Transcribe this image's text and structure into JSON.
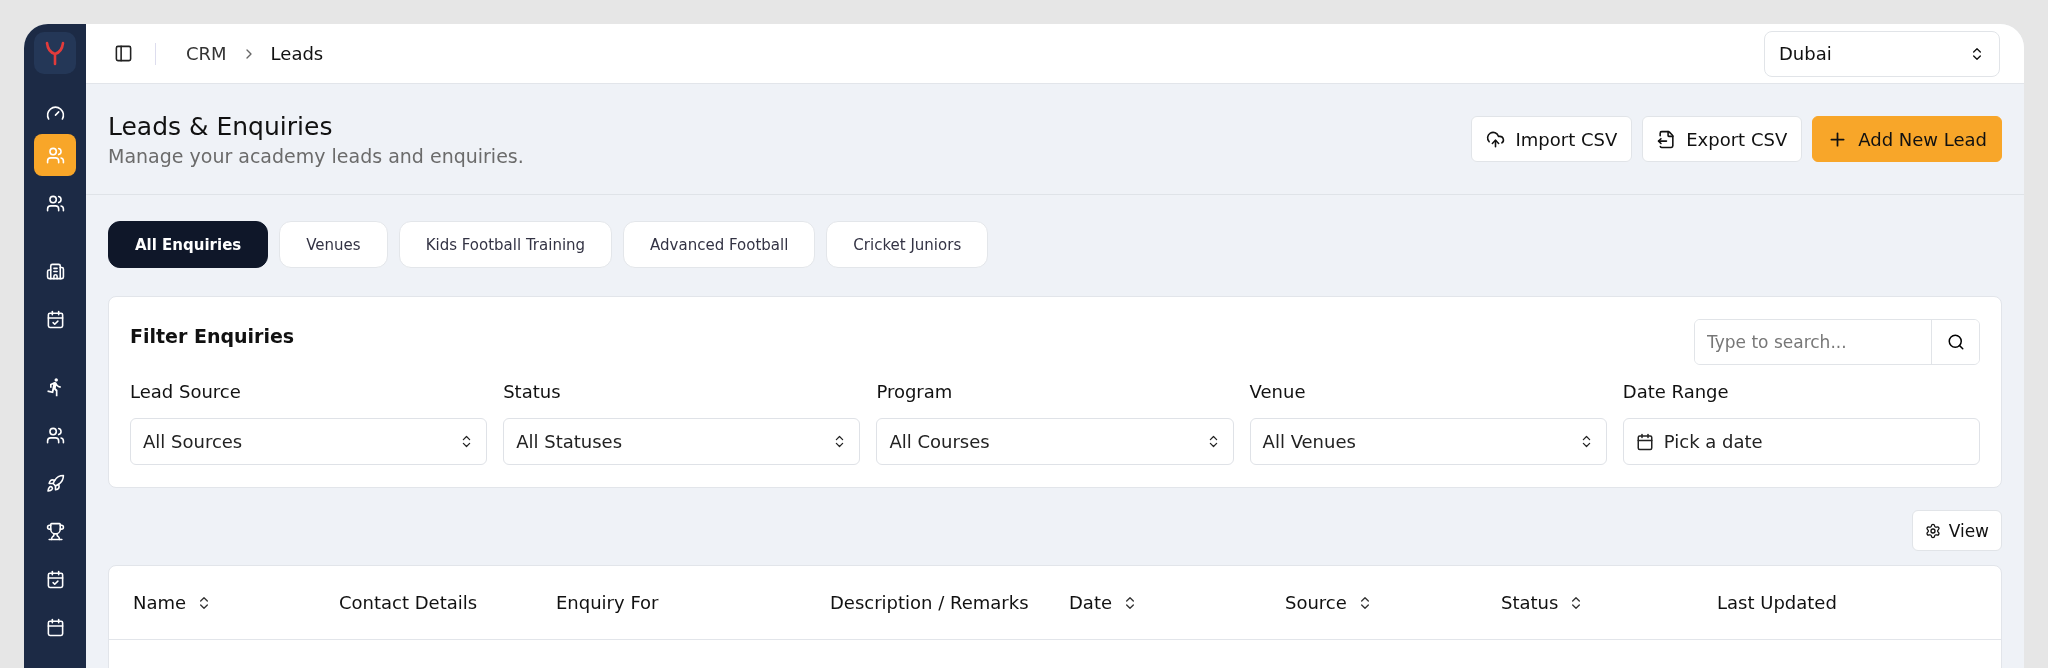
{
  "sidebar": {
    "items": [
      {
        "kind": "gauge",
        "selected": false
      },
      {
        "kind": "users",
        "selected": true
      },
      {
        "kind": "users",
        "selected": false
      },
      {
        "kind": "building",
        "selected": false
      },
      {
        "kind": "calendar-check",
        "selected": false
      },
      {
        "kind": "run",
        "selected": false
      },
      {
        "kind": "users",
        "selected": false
      },
      {
        "kind": "rocket",
        "selected": false
      },
      {
        "kind": "trophy",
        "selected": false
      },
      {
        "kind": "calendar-check",
        "selected": false
      },
      {
        "kind": "calendar",
        "selected": false
      }
    ]
  },
  "breadcrumbs": [
    "CRM",
    "Leads"
  ],
  "location_select": {
    "value": "Dubai"
  },
  "header": {
    "title": "Leads & Enquiries",
    "subtitle": "Manage your academy leads and enquiries."
  },
  "actions": [
    {
      "kind": "import",
      "label": "Import CSV"
    },
    {
      "kind": "export",
      "label": "Export CSV"
    },
    {
      "kind": "add",
      "label": "Add New Lead"
    }
  ],
  "tabs": [
    {
      "label": "All Enquiries",
      "selected": true
    },
    {
      "label": "Venues",
      "selected": false
    },
    {
      "label": "Kids Football Training",
      "selected": false
    },
    {
      "label": "Advanced Football",
      "selected": false
    },
    {
      "label": "Cricket Juniors",
      "selected": false
    }
  ],
  "filters": {
    "title": "Filter Enquiries",
    "search": {
      "placeholder": "Type to search..."
    },
    "fields": [
      {
        "label": "Lead Source",
        "value": "All Sources",
        "kind": "select"
      },
      {
        "label": "Status",
        "value": "All Statuses",
        "kind": "select"
      },
      {
        "label": "Program",
        "value": "All Courses",
        "kind": "select"
      },
      {
        "label": "Venue",
        "value": "All Venues",
        "kind": "select"
      },
      {
        "label": "Date Range",
        "value": "Pick a date",
        "kind": "date"
      }
    ]
  },
  "view_button": {
    "label": "View"
  },
  "table": {
    "columns": [
      {
        "label": "Name",
        "sortable": true
      },
      {
        "label": "Contact Details",
        "sortable": false
      },
      {
        "label": "Enquiry For",
        "sortable": false
      },
      {
        "label": "Description / Remarks",
        "sortable": false
      },
      {
        "label": "Date",
        "sortable": true
      },
      {
        "label": "Source",
        "sortable": true
      },
      {
        "label": "Status",
        "sortable": true
      },
      {
        "label": "Last Updated",
        "sortable": false
      }
    ]
  }
}
